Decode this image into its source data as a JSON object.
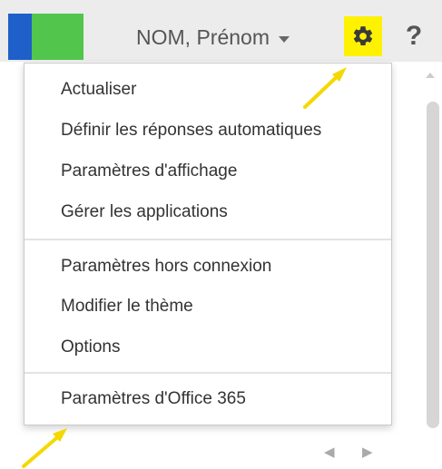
{
  "header": {
    "user_name": "NOM, Prénom",
    "help_label": "?",
    "icons": {
      "settings": "gear-icon",
      "user_caret": "chevron-down-icon"
    }
  },
  "menu": {
    "groups": [
      [
        "Actualiser",
        "Définir les réponses automatiques",
        "Paramètres d'affichage",
        "Gérer les applications"
      ],
      [
        "Paramètres hors connexion",
        "Modifier le thème",
        "Options"
      ],
      [
        "Paramètres d'Office 365"
      ]
    ]
  },
  "nav": {
    "prev": "◀",
    "next": "▶"
  },
  "colors": {
    "tile_blue": "#1f5fc9",
    "tile_green": "#52c64c",
    "highlight": "#fff200",
    "arrow": "#f5d800"
  }
}
